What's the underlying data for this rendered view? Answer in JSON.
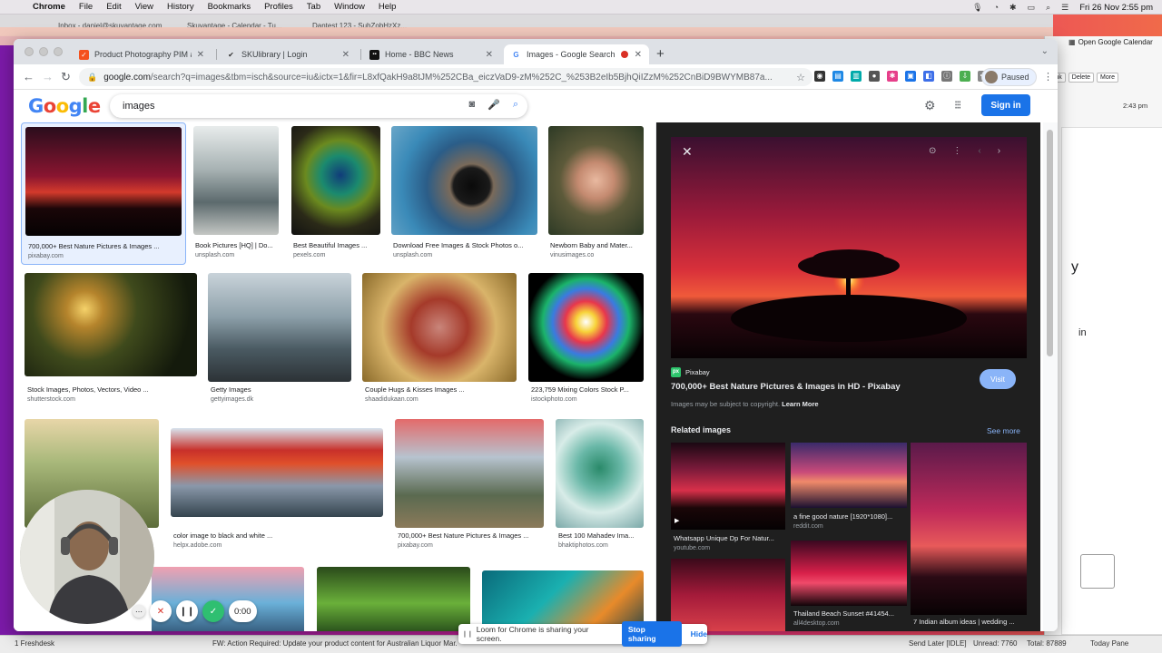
{
  "menubar": {
    "app": "Chrome",
    "items": [
      "File",
      "Edit",
      "View",
      "History",
      "Bookmarks",
      "Profiles",
      "Tab",
      "Window",
      "Help"
    ],
    "datetime": "Fri 26 Nov  2:55 pm"
  },
  "background_tabs": [
    "Inbox - daniel@skuvantage.com",
    "Skuvantage - Calendar - Tu...",
    "Dantest 123 - SuhZobHzXz..."
  ],
  "outlook": {
    "open_calendar": "Open Google Calendar",
    "buttons": [
      "Junk",
      "Delete",
      "More"
    ],
    "time": "2:43 pm",
    "fragment_y": "y",
    "fragment_in": "in"
  },
  "statusbar": {
    "left": "1 Freshdesk",
    "middle": "FW: Action Required: Update your product content for Australian Liquor Mar...",
    "send_later": "Send Later [IDLE]",
    "unread": "Unread: 7760",
    "total": "Total: 87889",
    "today_pane": "Today Pane"
  },
  "chrome": {
    "tabs": [
      {
        "title": "Product Photography PIM and",
        "color": "#f4511e",
        "glyph": "✓"
      },
      {
        "title": "SKUlibrary | Login",
        "color": "#ffffff",
        "glyph": "✔"
      },
      {
        "title": "Home - BBC News",
        "color": "#111111",
        "glyph": "▪"
      },
      {
        "title": "Images - Google Search",
        "color": "#ffffff",
        "glyph": "G"
      }
    ],
    "url_host": "google.com",
    "url_path": "/search?q=images&tbm=isch&source=iu&ictx=1&fir=L8xfQakH9a8tJM%252CBa_eiczVaD9-zM%252C_%253B2eIb5BjhQiIZzM%252CnBiD9BWYMB87a...",
    "profile": "Paused"
  },
  "google": {
    "query": "images",
    "signin": "Sign in"
  },
  "results": [
    {
      "caption": "700,000+ Best Nature Pictures & Images ...",
      "source": "pixabay.com",
      "bg": "linear-gradient(180deg,#2a0d1c 0%,#8a1530 45%,#d33a2c 60%,#1a0608 75%,#050203 100%)"
    },
    {
      "caption": "Book Pictures [HQ] | Do...",
      "source": "unsplash.com",
      "bg": "linear-gradient(180deg,#e8ecec 0%,#a7b2b3 40%,#5c6a6d 70%,#c4c7c4 100%)"
    },
    {
      "caption": "Best Beautiful Images ...",
      "source": "pexels.com",
      "bg": "radial-gradient(circle at 55% 45%,#103c7a 0%,#1b8a6e 25%,#6b8a1f 45%,#2b2a18 70%,#111 100%)"
    },
    {
      "caption": "Download Free Images & Stock Photos o...",
      "source": "unsplash.com",
      "bg": "radial-gradient(circle at 55% 55%,#0a0a0a 0%,#1a1a1a 18%,#7a6a5a 22%,#2b5d88 45%,#3a8ab8 70%,#6aa6c8 100%)"
    },
    {
      "caption": "Newborn Baby and Mater...",
      "source": "vinusimages.co",
      "bg": "radial-gradient(circle at 50% 50%,#e9b9a0 0%,#c48a70 25%,#5d5a3a 50%,#2d3a25 100%)"
    },
    {
      "caption": "Stock Images, Photos, Vectors, Video ...",
      "source": "shutterstock.com",
      "bg": "radial-gradient(circle at 35% 35%,#f5d26a 0%,#b5842c 14%,#3f4a1c 40%,#141a0c 80%)"
    },
    {
      "caption": "Getty Images",
      "source": "gettyimages.dk",
      "bg": "linear-gradient(180deg,#c9d3da 0%,#8da0aa 40%,#4a5a62 70%,#2c3236 100%)"
    },
    {
      "caption": "Couple Hugs & Kisses Images ...",
      "source": "shaadidukaan.com",
      "bg": "radial-gradient(circle at 50% 50%,#c9857a 0%,#a53a2a 30%,#d9b46a 60%,#8a6a2a 100%)"
    },
    {
      "caption": "223,759 Mixing Colors Stock P...",
      "source": "istockphoto.com",
      "bg": "radial-gradient(circle at 50% 45%,#ffffff 0%,#f7d33a 12%,#e8364c 25%,#3a7be0 40%,#1bb36a 52%,#000 70%)"
    },
    {
      "caption": "...",
      "source": "",
      "bg": "linear-gradient(180deg,#e8d6a8 0%,#a8b87a 40%,#5d6d3a 100%)"
    },
    {
      "caption": "color image to black and white ...",
      "source": "helpx.adobe.com",
      "bg": "linear-gradient(180deg,#d8e4ee 0%,#c8302a 25%,#e0502a 40%,#8a98aa 65%,#34444e 100%)"
    },
    {
      "caption": "700,000+ Best Nature Pictures & Images ...",
      "source": "pixabay.com",
      "bg": "linear-gradient(180deg,#e46a6a 0%,#b7c3cf 35%,#5a6a50 70%,#8b7a5a 100%)"
    },
    {
      "caption": "Best 100 Mahadev Ima...",
      "source": "bhaktiphotos.com",
      "bg": "radial-gradient(circle at 50% 45%,#2a8a6a 0%,#6ab8a8 30%,#d8ece8 60%,#7aa8a8 100%)"
    },
    {
      "caption": "",
      "source": "",
      "bg": "linear-gradient(180deg,#f0a0b0 0%,#6ab0d8 50%,#2a4a6a 100%)"
    },
    {
      "caption": "",
      "source": "",
      "bg": "linear-gradient(180deg,#2a4a1a 0%,#6ab03a 50%,#1a3a14 100%)"
    },
    {
      "caption": "",
      "source": "",
      "bg": "linear-gradient(135deg,#0a6a7a 0%,#1ab0b0 40%,#e88a2a 70%,#0a3a4a 100%)"
    }
  ],
  "preview": {
    "source_name": "Pixabay",
    "title": "700,000+ Best Nature Pictures & Images in HD - Pixabay",
    "visit": "Visit",
    "copyright": "Images may be subject to copyright.",
    "learn_more": "Learn More",
    "related_heading": "Related images",
    "see_more": "See more",
    "related": [
      {
        "caption": "Whatsapp Unique Dp For Natur...",
        "source": "youtube.com"
      },
      {
        "caption": "a fine good nature [1920*1080]...",
        "source": "reddit.com"
      },
      {
        "caption": "",
        "source": ""
      },
      {
        "caption": "Thailand Beach Sunset #41454...",
        "source": "all4desktop.com"
      },
      {
        "caption": "7 Indian album ideas | wedding ...",
        "source": ""
      }
    ]
  },
  "loom": {
    "timer": "0:00",
    "share_text": "Loom for Chrome is sharing your screen.",
    "stop": "Stop sharing",
    "hide": "Hide"
  }
}
